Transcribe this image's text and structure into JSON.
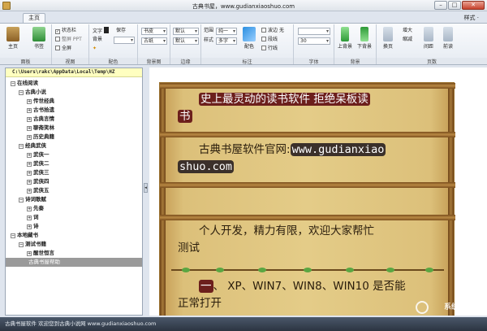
{
  "window": {
    "title": "古典书屋，www.gudianxiaoshuo.com",
    "min_label": "–",
    "max_label": "□",
    "close_label": "✕"
  },
  "ribbon_tabs": {
    "main_tab": "主页",
    "style_menu": "样式 ·"
  },
  "ribbon": {
    "groups": {
      "panel": {
        "label": "面板",
        "home": "主页",
        "bookmark": "书签"
      },
      "view": {
        "label": "视图",
        "statusbar": "状态栏",
        "tts": "整屏 PPT",
        "fullscreen": "全屏"
      },
      "color": {
        "label": "配色",
        "text": "文字",
        "save": "保存",
        "background": "背景"
      },
      "bgimage": {
        "label": "背景图",
        "combo1": "书皮",
        "combo2": "古纸"
      },
      "border": {
        "label": "边缘",
        "combo1": "默认",
        "combo2": "默认"
      },
      "annotation": {
        "label": "标注",
        "range": "范围",
        "range_value": "纯一",
        "style": "样式",
        "style_value": "多字",
        "color_btn": "配色",
        "wave": "波边",
        "wave_value": "无",
        "underline": "段线",
        "lineline": "行线"
      },
      "font": {
        "label": "字体",
        "size_value": "30"
      },
      "bg_nav": {
        "label": "背景",
        "prev": "上背景",
        "next": "下背景"
      },
      "page": {
        "label": "页数",
        "turn": "换页",
        "enlarge": "增大",
        "shrink": "缩减",
        "interval": "间距",
        "prev_page": "前读"
      }
    }
  },
  "sidebar": {
    "path": "C:\\Users\\rakc\\AppData\\Local\\Temp\\HZ",
    "items": [
      {
        "text": "在线阅读",
        "depth": 0,
        "toggle": "−"
      },
      {
        "text": "古典小说",
        "depth": 1,
        "toggle": "−"
      },
      {
        "text": "传世经典",
        "depth": 2,
        "toggle": "+"
      },
      {
        "text": "古书拾遗",
        "depth": 2,
        "toggle": "+"
      },
      {
        "text": "古典言情",
        "depth": 2,
        "toggle": "+"
      },
      {
        "text": "聊斋笑林",
        "depth": 2,
        "toggle": "+"
      },
      {
        "text": "历史典籍",
        "depth": 2,
        "toggle": "+"
      },
      {
        "text": "经典武侠",
        "depth": 1,
        "toggle": "−"
      },
      {
        "text": "武侠一",
        "depth": 2,
        "toggle": "+"
      },
      {
        "text": "武侠二",
        "depth": 2,
        "toggle": "+"
      },
      {
        "text": "武侠三",
        "depth": 2,
        "toggle": "+"
      },
      {
        "text": "武侠四",
        "depth": 2,
        "toggle": "+"
      },
      {
        "text": "武侠五",
        "depth": 2,
        "toggle": "+"
      },
      {
        "text": "诗词歌赋",
        "depth": 1,
        "toggle": "−"
      },
      {
        "text": "先秦",
        "depth": 2,
        "toggle": "+"
      },
      {
        "text": "词",
        "depth": 2,
        "toggle": "+"
      },
      {
        "text": "诗",
        "depth": 2,
        "toggle": "+"
      },
      {
        "text": "本地藏书",
        "depth": 0,
        "toggle": "−"
      },
      {
        "text": "测试书籍",
        "depth": 1,
        "toggle": "−"
      },
      {
        "text": "醒世恒言",
        "depth": 2,
        "toggle": "+"
      }
    ],
    "selected": "古典书屋帮助"
  },
  "content": {
    "p1_hl": "史上最灵动的读书软件  拒绝呆板读",
    "p1_tail": "书",
    "p2_text": "古典书屋软件官网:",
    "p2_url1": "www.gudianxiao",
    "p2_url2": "shuo.com",
    "p3_line1": "个人开发，精力有限，欢迎大家帮忙",
    "p3_line2": "测试",
    "p4_hl": "一",
    "p4_line1": "、 XP、WIN7、WIN8、WIN10 是否能",
    "p4_line2": "正常打开"
  },
  "watermark": "系统天地网",
  "statusbar": "古典书屋软件  欢迎您到古典小说网  www.gudianxiaoshuo.com",
  "colors": {
    "title_bar": "#dfe4ea",
    "paper": "#e4cc88",
    "highlight": "#6c1f1c",
    "statusbar": "#2b3441"
  }
}
